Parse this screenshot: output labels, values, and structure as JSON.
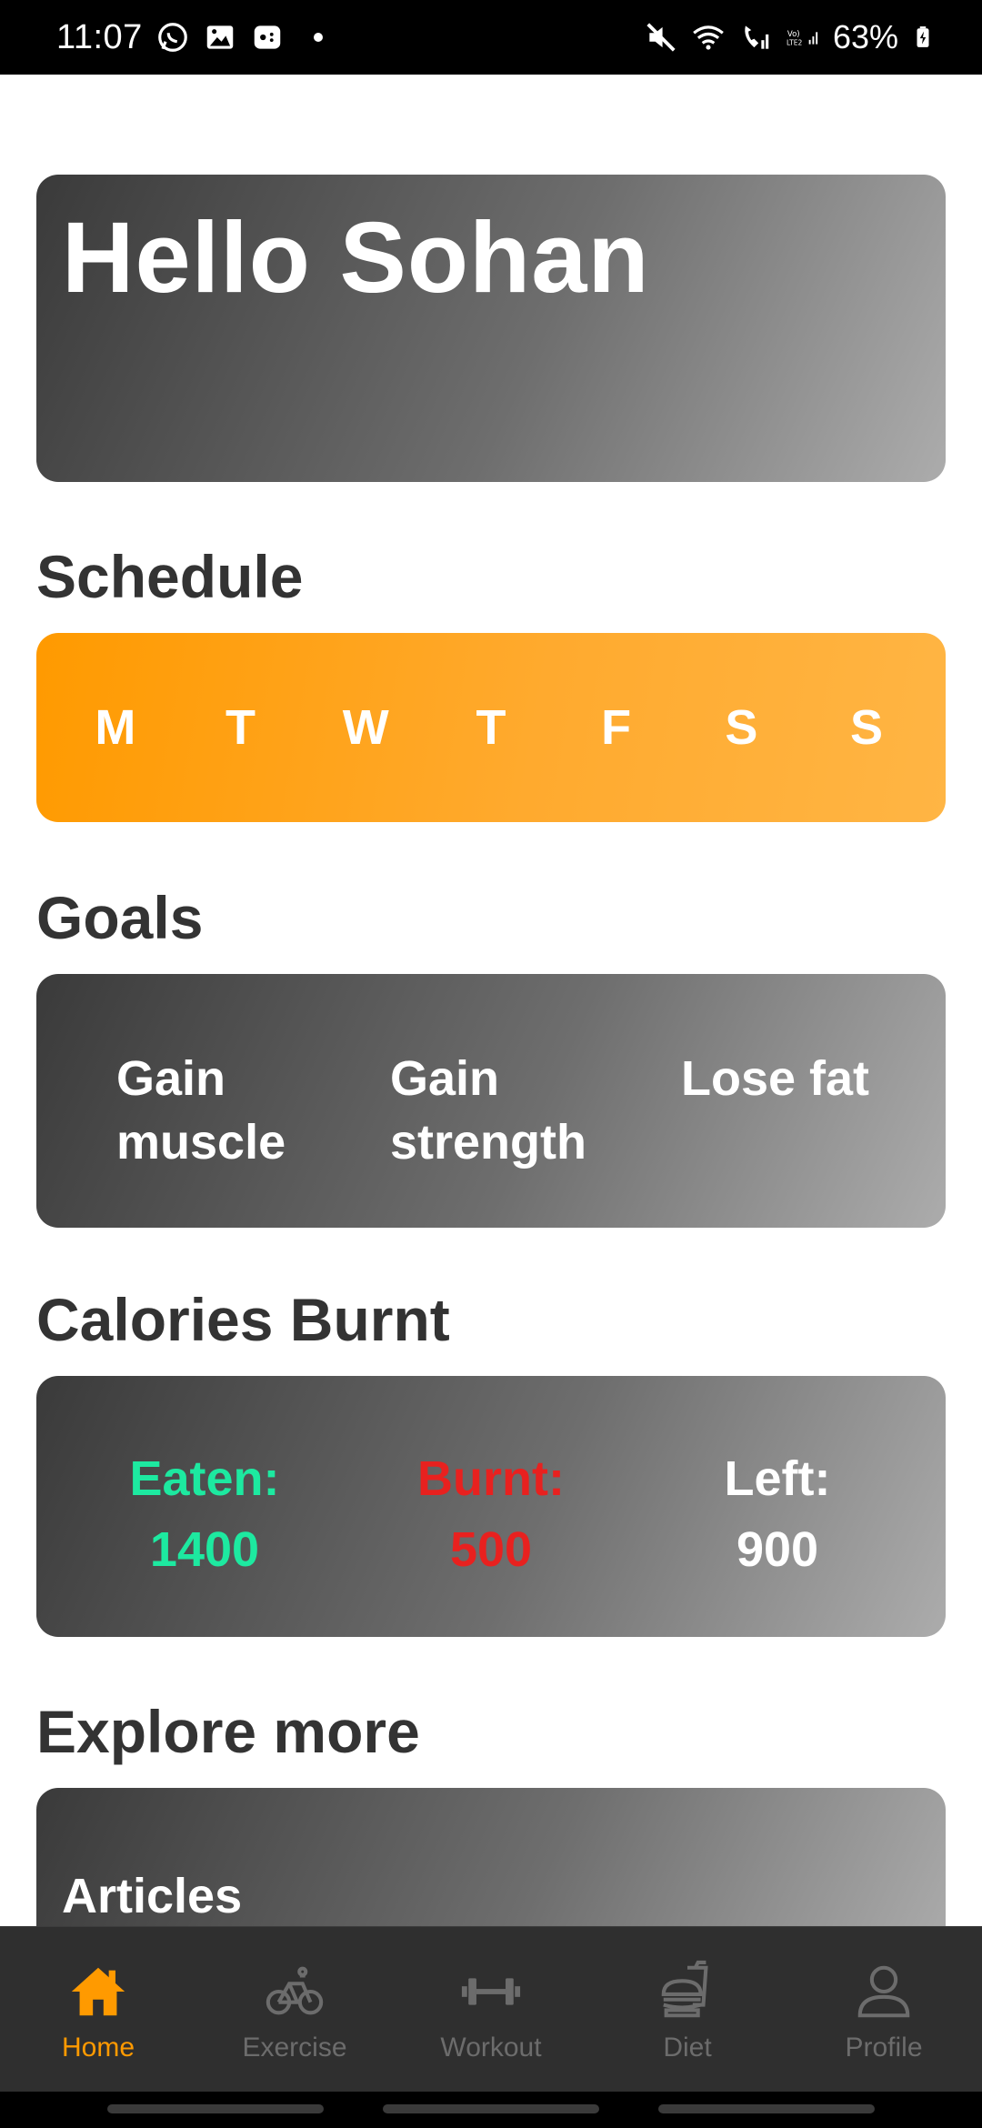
{
  "status_bar": {
    "time": "11:07",
    "battery": "63%",
    "lte_label": "LTE2"
  },
  "greeting": "Hello Sohan",
  "schedule": {
    "title": "Schedule",
    "days": [
      "M",
      "T",
      "W",
      "T",
      "F",
      "S",
      "S"
    ]
  },
  "goals": {
    "title": "Goals",
    "items": [
      {
        "line1": "Gain",
        "line2": "muscle"
      },
      {
        "line1": "Gain",
        "line2": "strength"
      },
      {
        "line1": "Lose fat",
        "line2": ""
      }
    ]
  },
  "calories": {
    "title": "Calories Burnt",
    "eaten_label": "Eaten:",
    "eaten_value": "1400",
    "burnt_label": "Burnt:",
    "burnt_value": "500",
    "left_label": "Left:",
    "left_value": "900",
    "colors": {
      "eaten": "#1de9a0",
      "burnt": "#e8211f",
      "left": "#ffffff"
    }
  },
  "explore": {
    "title": "Explore more",
    "card_label": "Articles"
  },
  "nav": {
    "items": [
      {
        "label": "Home",
        "icon": "home-icon",
        "active": true
      },
      {
        "label": "Exercise",
        "icon": "bicycle-icon",
        "active": false
      },
      {
        "label": "Workout",
        "icon": "dumbbell-icon",
        "active": false
      },
      {
        "label": "Diet",
        "icon": "burger-drink-icon",
        "active": false
      },
      {
        "label": "Profile",
        "icon": "person-icon",
        "active": false
      }
    ],
    "accent": "#ff9a00",
    "inactive": "#6c6c6c"
  }
}
